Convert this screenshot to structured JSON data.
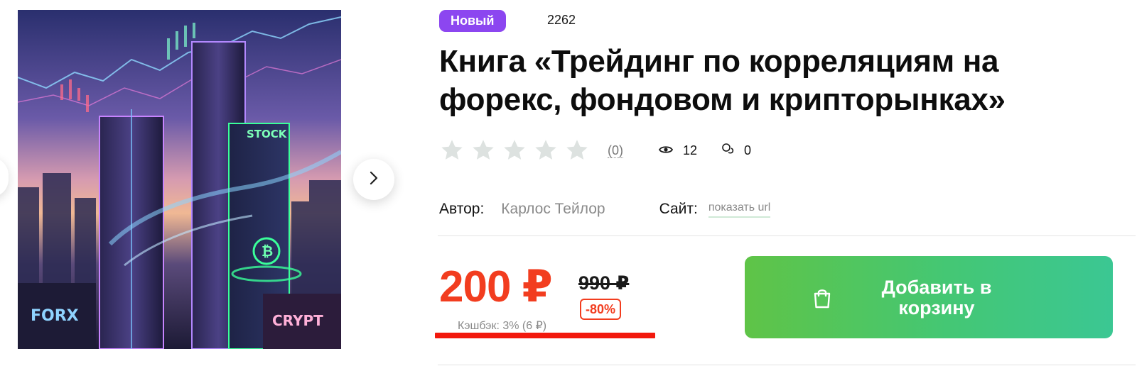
{
  "product": {
    "badge": "Новый",
    "id": "2262",
    "title": "Книга «Трейдинг по корреляциям на форекс, фондовом и крипторынках»"
  },
  "cover": {
    "sign_forex": "FORX",
    "sign_stock": "STOCK",
    "sign_crypto": "CRYPT",
    "coin_symbol": "₿"
  },
  "rating": {
    "stars_total": 5,
    "stars_filled": 0,
    "count_label": "(0)"
  },
  "stats": {
    "views": "12",
    "comments": "0"
  },
  "meta": {
    "author_label": "Автор:",
    "author_name": "Карлос Тейлор",
    "site_label": "Сайт:",
    "site_link": "показать url"
  },
  "pricing": {
    "price": "200 ₽",
    "old_price": "990 ₽",
    "discount": "-80%",
    "cashback": "Кэшбэк: 3% (6 ₽)"
  },
  "cart": {
    "button_label": "Добавить в корзину"
  },
  "colors": {
    "badge": "#8c46f0",
    "price": "#f23d1f",
    "cart_start": "#5fc447",
    "cart_end": "#3bc793",
    "star_empty": "#dde2e0"
  },
  "icons": {
    "next": "chevron-right-icon",
    "views": "eye-icon",
    "comments": "comment-icon",
    "cart": "shopping-bag-icon",
    "rating": "star-icon"
  }
}
